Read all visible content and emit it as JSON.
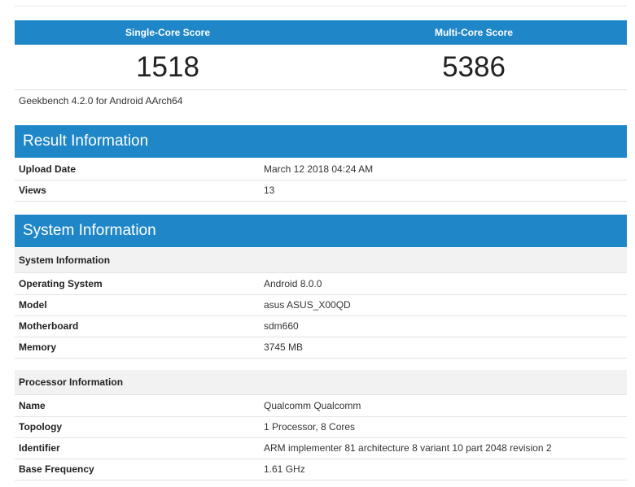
{
  "scores": {
    "single_label": "Single-Core Score",
    "multi_label": "Multi-Core Score",
    "single_value": "1518",
    "multi_value": "5386"
  },
  "version_text": "Geekbench 4.2.0 for Android AArch64",
  "result_info": {
    "title": "Result Information",
    "rows": [
      {
        "key": "Upload Date",
        "value": "March 12 2018 04:24 AM"
      },
      {
        "key": "Views",
        "value": "13"
      }
    ]
  },
  "system_info": {
    "title": "System Information",
    "system_sub": "System Information",
    "system_rows": [
      {
        "key": "Operating System",
        "value": "Android 8.0.0"
      },
      {
        "key": "Model",
        "value": "asus ASUS_X00QD"
      },
      {
        "key": "Motherboard",
        "value": "sdm660"
      },
      {
        "key": "Memory",
        "value": "3745 MB"
      }
    ],
    "processor_sub": "Processor Information",
    "processor_rows": [
      {
        "key": "Name",
        "value": "Qualcomm Qualcomm"
      },
      {
        "key": "Topology",
        "value": "1 Processor, 8 Cores"
      },
      {
        "key": "Identifier",
        "value": "ARM implementer 81 architecture 8 variant 10 part 2048 revision 2"
      },
      {
        "key": "Base Frequency",
        "value": "1.61 GHz"
      }
    ]
  },
  "colors": {
    "header_blue": "#1f86c8"
  }
}
